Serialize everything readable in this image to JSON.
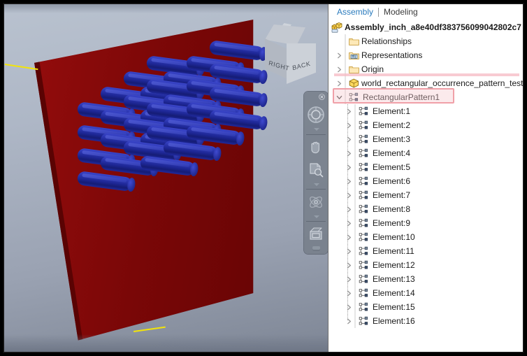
{
  "window": {
    "accent_pink": "#f0a0a8",
    "tab_active_color": "#2a7bbd",
    "plate_color": "#7a0707",
    "cylinder_color": "#1e2796",
    "highlight_edge_color": "#f2e40a",
    "viewport_bg_top": "#b9c2cf",
    "viewport_bg_bottom": "#7e8695"
  },
  "viewport": {
    "name": "3d-viewport",
    "viewcube": {
      "face_right": "RIGHT",
      "face_back": "BACK"
    },
    "navbar": {
      "close_label": "×",
      "buttons": [
        {
          "name": "steering-wheel-icon",
          "label": "Full Navigation Wheel"
        },
        {
          "name": "pan-hand-icon",
          "label": "Pan"
        },
        {
          "name": "zoom-window-icon",
          "label": "Zoom"
        },
        {
          "name": "orbit-icon",
          "label": "Free Orbit"
        },
        {
          "name": "look-at-icon",
          "label": "Look At"
        }
      ]
    },
    "model": {
      "plate_label": "Dark red rectangular plate",
      "pattern_rows": 4,
      "pattern_cols": 4,
      "cylinder_count": 16
    }
  },
  "browser": {
    "tabs": [
      {
        "label": "Assembly",
        "active": true
      },
      {
        "label": "Modeling",
        "active": false
      }
    ],
    "tree": {
      "root": {
        "label": "Assembly_inch_a8e40df383756099042802c7",
        "icon": "assembly-icon"
      },
      "children": [
        {
          "label": "Relationships",
          "icon": "folder-icon",
          "indent": 1,
          "expandable": false
        },
        {
          "label": "Representations",
          "icon": "representations-icon",
          "indent": 1,
          "expandable": true
        },
        {
          "label": "Origin",
          "icon": "folder-icon",
          "indent": 1,
          "expandable": true
        },
        {
          "label": "world_rectangular_occurrence_pattern_test_asse",
          "icon": "part-cube-icon",
          "indent": 1,
          "expandable": true
        },
        {
          "label": "RectangularPattern1",
          "icon": "pattern-icon",
          "indent": 1,
          "expandable": true,
          "expanded": true,
          "selected": true
        }
      ],
      "elements": [
        {
          "label": "Element:1",
          "icon": "pattern-element-icon"
        },
        {
          "label": "Element:2",
          "icon": "pattern-element-icon"
        },
        {
          "label": "Element:3",
          "icon": "pattern-element-icon"
        },
        {
          "label": "Element:4",
          "icon": "pattern-element-icon"
        },
        {
          "label": "Element:5",
          "icon": "pattern-element-icon"
        },
        {
          "label": "Element:6",
          "icon": "pattern-element-icon"
        },
        {
          "label": "Element:7",
          "icon": "pattern-element-icon"
        },
        {
          "label": "Element:8",
          "icon": "pattern-element-icon"
        },
        {
          "label": "Element:9",
          "icon": "pattern-element-icon"
        },
        {
          "label": "Element:10",
          "icon": "pattern-element-icon"
        },
        {
          "label": "Element:11",
          "icon": "pattern-element-icon"
        },
        {
          "label": "Element:12",
          "icon": "pattern-element-icon"
        },
        {
          "label": "Element:13",
          "icon": "pattern-element-icon"
        },
        {
          "label": "Element:14",
          "icon": "pattern-element-icon"
        },
        {
          "label": "Element:15",
          "icon": "pattern-element-icon"
        },
        {
          "label": "Element:16",
          "icon": "pattern-element-icon"
        }
      ]
    }
  }
}
